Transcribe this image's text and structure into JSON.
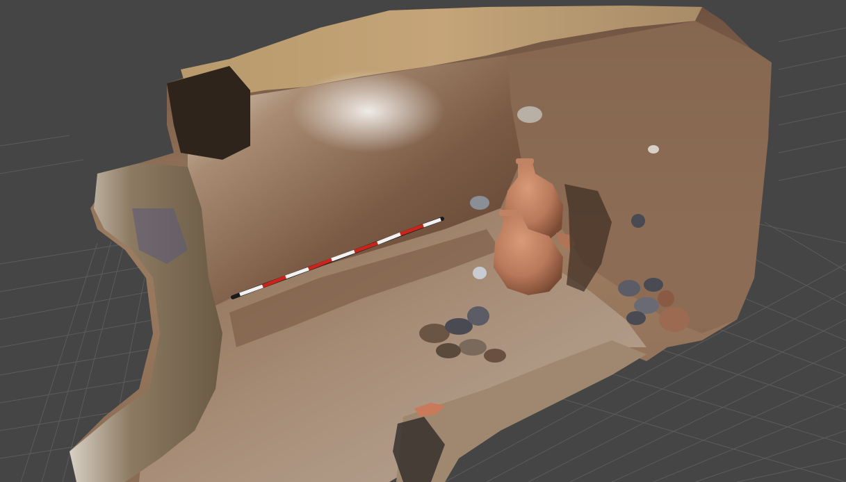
{
  "viewer": {
    "background_color": "#454545",
    "grid_line_color": "#5c5c5c",
    "grid_major_line_color": "#6a6a6a"
  },
  "model": {
    "soil_color_light": "#c9b49a",
    "soil_color_mid": "#9c7a5c",
    "soil_color_dark": "#5a4030",
    "amphora_color": "#b8785a",
    "scale_bar_colors": [
      "#c8261d",
      "#f2f2f2"
    ]
  }
}
